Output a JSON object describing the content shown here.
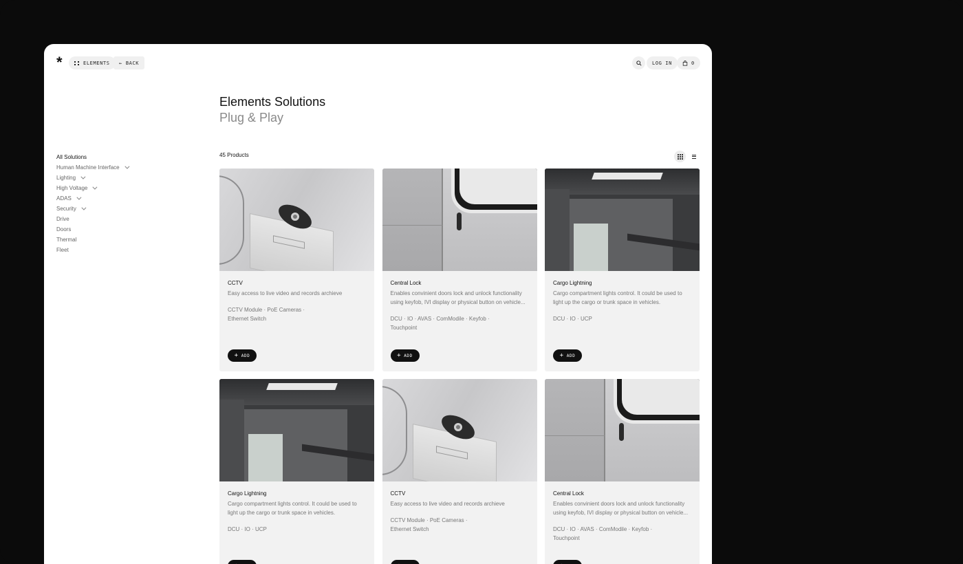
{
  "topbar": {
    "logo": "*",
    "elements_label": "ELEMENTS",
    "back_label": "BACK",
    "back_arrow": "←",
    "login_label": "LOG IN",
    "cart_count": "0"
  },
  "heading": {
    "title": "Elements Solutions",
    "subtitle": "Plug & Play"
  },
  "sidebar": {
    "items": [
      {
        "label": "All Solutions",
        "expandable": false,
        "active": true
      },
      {
        "label": "Human Machine Interface",
        "expandable": true,
        "active": false
      },
      {
        "label": "Lighting",
        "expandable": true,
        "active": false
      },
      {
        "label": "High Voltage",
        "expandable": true,
        "active": false
      },
      {
        "label": "ADAS",
        "expandable": true,
        "active": false
      },
      {
        "label": "Security",
        "expandable": true,
        "active": false
      },
      {
        "label": "Drive",
        "expandable": false,
        "active": false
      },
      {
        "label": "Doors",
        "expandable": false,
        "active": false
      },
      {
        "label": "Thermal",
        "expandable": false,
        "active": false
      },
      {
        "label": "Fleet",
        "expandable": false,
        "active": false
      }
    ]
  },
  "products": {
    "count_label": "45 Products",
    "add_label": "ADD",
    "add_icon": "+",
    "items": [
      {
        "image": "cctv",
        "title": "CCTV",
        "desc": "Easy access to live video and records archieve",
        "tags": "CCTV Module  ·  PoE Cameras  ·\nEthernet Switch"
      },
      {
        "image": "door",
        "title": "Central Lock",
        "desc": "Enables convinient doors lock and unlock functionality using keyfob, IVI display or physical button on vehicle...",
        "tags": "DCU  ·  IO  ·  AVAS  ·  ComModile  · Keyfob  ·\nTouchpoint"
      },
      {
        "image": "cargo",
        "title": "Cargo Lightning",
        "desc": "Cargo compartment lights control. It could be used to light up the cargo or trunk space in vehicles.",
        "tags": "DCU  ·  IO  ·  UCP"
      },
      {
        "image": "cargo",
        "title": "Cargo Lightning",
        "desc": "Cargo compartment lights control. It could be used to light up the cargo or trunk space in vehicles.",
        "tags": "DCU  ·  IO  ·  UCP"
      },
      {
        "image": "cctv",
        "title": "CCTV",
        "desc": "Easy access to live video and records archieve",
        "tags": "CCTV Module  ·  PoE Cameras  ·\nEthernet Switch"
      },
      {
        "image": "door",
        "title": "Central Lock",
        "desc": "Enables convinient doors lock and unlock functionality using keyfob, IVI display or physical button on vehicle...",
        "tags": "DCU  ·  IO  ·  AVAS  ·  ComModile  · Keyfob  ·\nTouchpoint"
      }
    ]
  },
  "colors": {
    "frame_bg": "#0b0b0b",
    "window_bg": "#ffffff",
    "card_bg": "#f2f2f2",
    "button_bg": "#111111",
    "muted_text": "#8a8a8a"
  }
}
